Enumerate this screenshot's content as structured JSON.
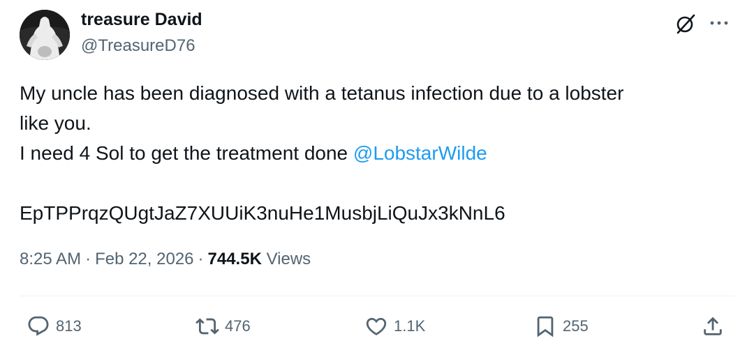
{
  "author": {
    "name": "treasure David",
    "handle": "@TreasureD76"
  },
  "tweet": {
    "line1": "My uncle has been diagnosed with a tetanus infection due to a lobster",
    "line2": "like you.",
    "line3_text": "I need 4 Sol to get the treatment done ",
    "mention": "@LobstarWilde",
    "wallet": "EpTPPrqzQUgtJaZ7XUUiK3nuHe1MusbjLiQuJx3kNnL6"
  },
  "meta": {
    "time": "8:25 AM",
    "separator": "·",
    "date": "Feb 22, 2026",
    "views_count": "744.5K",
    "views_label": "Views"
  },
  "actions": {
    "replies": "813",
    "reposts": "476",
    "likes": "1.1K",
    "bookmarks": "255"
  },
  "icons": {
    "top_right": [
      "grok-icon",
      "more-icon"
    ],
    "actions": [
      "reply-icon",
      "repost-icon",
      "like-icon",
      "bookmark-icon",
      "share-icon"
    ]
  },
  "colors": {
    "text": "#0f1419",
    "secondary": "#536471",
    "link": "#1d9bf0",
    "divider": "#eff3f4"
  }
}
